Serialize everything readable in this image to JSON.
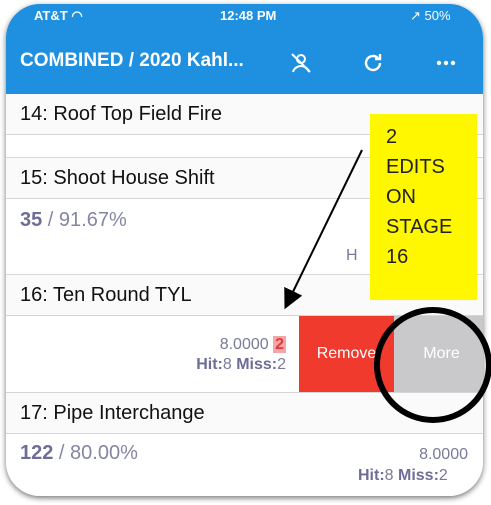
{
  "status": {
    "carrier": "AT&T",
    "time": "12:48 PM",
    "battery": "50%"
  },
  "nav": {
    "title": "COMBINED / 2020 Kahl..."
  },
  "stages": [
    {
      "title": "14: Roof Top Field Fire"
    },
    {
      "title": "15: Shoot House Shift",
      "points": "35",
      "percent": " / 91.67%",
      "hit_partial": "H"
    },
    {
      "title": "16: Ten Round TYL",
      "time": "8.0000",
      "edits": "2",
      "hit": "Hit:",
      "hit_val": "8",
      "miss": " Miss:",
      "miss_val": "2",
      "actions": {
        "remove": "Remove",
        "more": "More"
      }
    },
    {
      "title": "17: Pipe Interchange",
      "points": "122",
      "percent": " / 80.00%",
      "time": "8.0000",
      "hit": "Hit:",
      "hit_val": "8",
      "miss": " Miss:",
      "miss_val": "2"
    }
  ],
  "annotation": {
    "lines": [
      "2",
      "EDITS",
      "ON",
      "STAGE",
      "16"
    ]
  },
  "colors": {
    "nav_bg": "#1f8fe0",
    "remove": "#f03a2e",
    "more": "#c9c9cc",
    "callout": "#fff700"
  }
}
